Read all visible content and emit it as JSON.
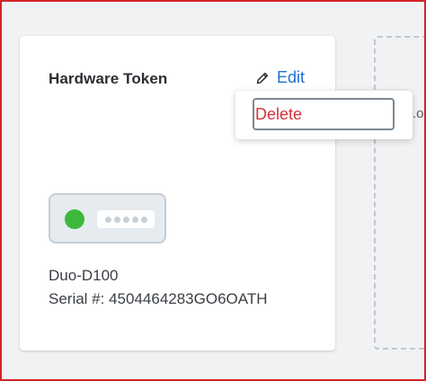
{
  "card": {
    "title": "Hardware Token",
    "edit_label": "Edit",
    "device_name": "Duo-D100",
    "serial_text": "Serial #: 4504464283GO6OATH"
  },
  "dropdown": {
    "delete_label": "Delete"
  },
  "add_placeholder": {
    "text": ".o"
  },
  "colors": {
    "accent_blue": "#1f6fd1",
    "danger_red": "#d6333c",
    "status_green": "#3cb93c",
    "frame_red": "#d4232b"
  },
  "icons": {
    "edit": "pencil-icon",
    "token_led": "status-led-icon"
  }
}
